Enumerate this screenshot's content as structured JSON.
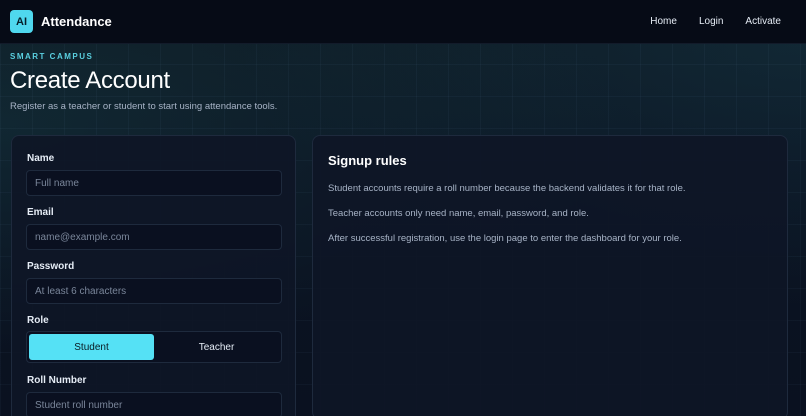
{
  "nav": {
    "logo_text": "AI",
    "brand": "Attendance",
    "links": [
      "Home",
      "Login",
      "Activate"
    ]
  },
  "header": {
    "eyebrow": "SMART CAMPUS",
    "title": "Create Account",
    "subtitle": "Register as a teacher or student to start using attendance tools."
  },
  "form": {
    "name": {
      "label": "Name",
      "placeholder": "Full name",
      "value": ""
    },
    "email": {
      "label": "Email",
      "placeholder": "name@example.com",
      "value": ""
    },
    "password": {
      "label": "Password",
      "placeholder": "At least 6 characters",
      "value": ""
    },
    "role": {
      "label": "Role",
      "options": [
        "Student",
        "Teacher"
      ],
      "selected": "Student"
    },
    "roll": {
      "label": "Roll Number",
      "placeholder": "Student roll number",
      "value": ""
    }
  },
  "rules": {
    "title": "Signup rules",
    "items": [
      "Student accounts require a roll number because the backend validates it for that role.",
      "Teacher accounts only need name, email, password, and role.",
      "After successful registration, use the login page to enter the dashboard for your role."
    ]
  },
  "colors": {
    "accent": "#55e1f5",
    "background": "#0b1220",
    "card": "#0e1626"
  }
}
